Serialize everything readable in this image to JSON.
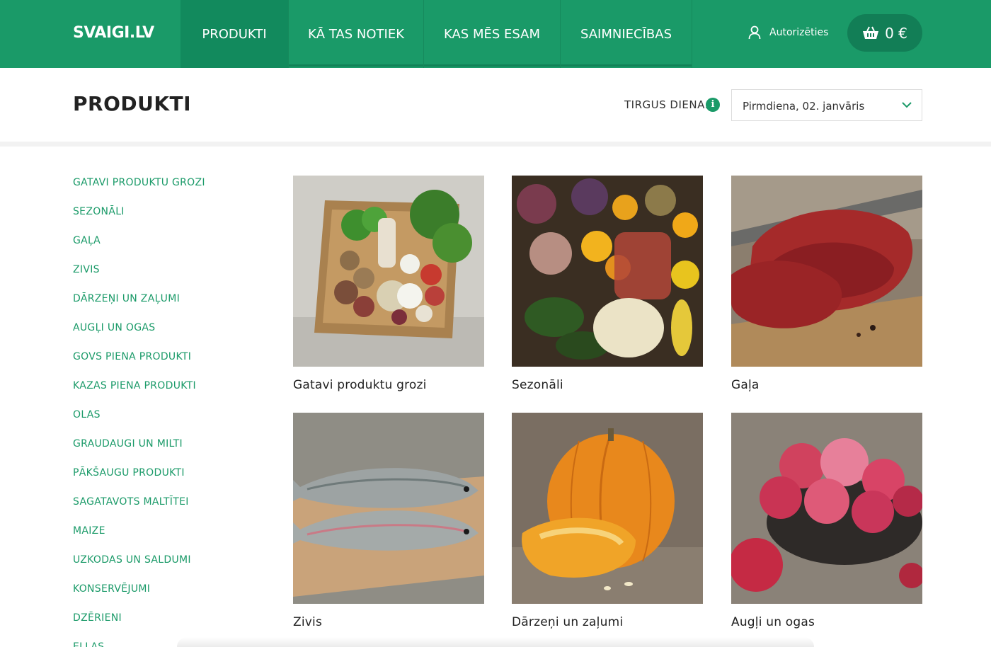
{
  "header": {
    "logo": "SVAIGI.LV",
    "nav": [
      {
        "label": "PRODUKTI",
        "active": true
      },
      {
        "label": "KĀ TAS NOTIEK",
        "active": false
      },
      {
        "label": "KAS MĒS ESAM",
        "active": false
      },
      {
        "label": "SAIMNIECĪBAS",
        "active": false
      }
    ],
    "login_label": "Autorizēties",
    "cart_total": "0 €"
  },
  "page": {
    "title": "PRODUKTI",
    "market_day_label": "TIRGUS DIENA:",
    "info_icon": "i",
    "market_day_value": "Pirmdiena, 02. janvāris"
  },
  "sidebar": {
    "items": [
      "GATAVI PRODUKTU GROZI",
      "SEZONĀLI",
      "GAĻA",
      "ZIVIS",
      "DĀRZEŅI UN ZAĻUMI",
      "AUGĻI UN OGAS",
      "GOVS PIENA PRODUKTI",
      "KAZAS PIENA PRODUKTI",
      "OLAS",
      "GRAUDAUGI UN MILTI",
      "PĀKŠAUGU PRODUKTI",
      "SAGATAVOTS MALTĪTEI",
      "MAIZE",
      "UZKODAS UN SALDUMI",
      "KONSERVĒJUMI",
      "DZĒRIENI",
      "EĻĻAS"
    ]
  },
  "products": [
    {
      "label": "Gatavi produktu grozi",
      "icon": "produce-box-photo"
    },
    {
      "label": "Sezonāli",
      "icon": "seasonal-vegetables-photo"
    },
    {
      "label": "Gaļa",
      "icon": "beef-steak-photo"
    },
    {
      "label": "Zivis",
      "icon": "trout-photo"
    },
    {
      "label": "Dārzeņi un zaļumi",
      "icon": "pumpkin-photo"
    },
    {
      "label": "Augļi un ogas",
      "icon": "apples-photo"
    }
  ],
  "colors": {
    "brand_green": "#1a9a68",
    "nav_active": "#128a5d",
    "cart_bg": "#127e56"
  }
}
